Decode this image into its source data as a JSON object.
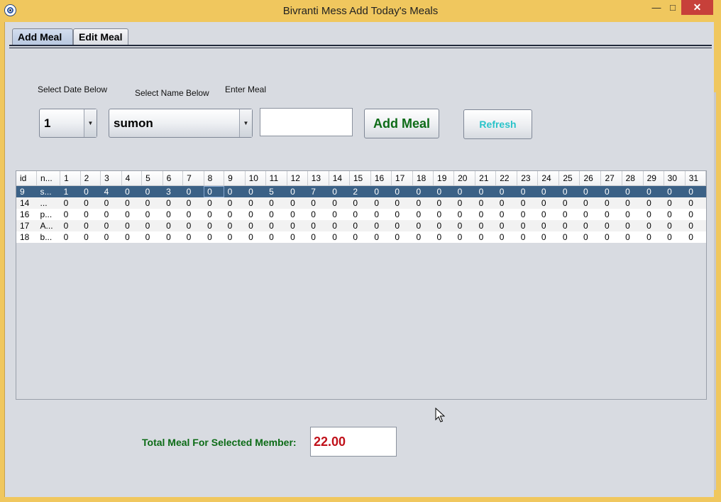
{
  "window": {
    "title": "Bivranti Mess Add Today's Meals",
    "min_glyph": "—",
    "max_glyph": "□",
    "close_glyph": "✕",
    "app_icon": "gear-logo-icon"
  },
  "tabs": [
    {
      "label": "Add Meal",
      "active": true
    },
    {
      "label": "Edit Meal",
      "active": false
    }
  ],
  "form": {
    "date_label": "Select Date Below",
    "name_label": "Select Name Below",
    "meal_label": "Enter Meal",
    "date_value": "1",
    "name_value": "sumon",
    "meal_value": "",
    "add_button": "Add Meal",
    "refresh_button": "Refresh"
  },
  "colors": {
    "add_button_text": "#0c6b16",
    "refresh_button_text": "#29c3c9",
    "total_label": "#0c6b16",
    "total_value": "#c0111a",
    "selected_row": "#3b6186",
    "title_bar": "#f0c75e"
  },
  "table": {
    "headers": [
      "id",
      "n...",
      "1",
      "2",
      "3",
      "4",
      "5",
      "6",
      "7",
      "8",
      "9",
      "10",
      "11",
      "12",
      "13",
      "14",
      "15",
      "16",
      "17",
      "18",
      "19",
      "20",
      "21",
      "22",
      "23",
      "24",
      "25",
      "26",
      "27",
      "28",
      "29",
      "30",
      "31"
    ],
    "rows": [
      [
        "9",
        "s...",
        "1",
        "0",
        "4",
        "0",
        "0",
        "3",
        "0",
        "0",
        "0",
        "0",
        "5",
        "0",
        "7",
        "0",
        "2",
        "0",
        "0",
        "0",
        "0",
        "0",
        "0",
        "0",
        "0",
        "0",
        "0",
        "0",
        "0",
        "0",
        "0",
        "0",
        "0"
      ],
      [
        "14",
        "...",
        "0",
        "0",
        "0",
        "0",
        "0",
        "0",
        "0",
        "0",
        "0",
        "0",
        "0",
        "0",
        "0",
        "0",
        "0",
        "0",
        "0",
        "0",
        "0",
        "0",
        "0",
        "0",
        "0",
        "0",
        "0",
        "0",
        "0",
        "0",
        "0",
        "0",
        "0"
      ],
      [
        "16",
        "p...",
        "0",
        "0",
        "0",
        "0",
        "0",
        "0",
        "0",
        "0",
        "0",
        "0",
        "0",
        "0",
        "0",
        "0",
        "0",
        "0",
        "0",
        "0",
        "0",
        "0",
        "0",
        "0",
        "0",
        "0",
        "0",
        "0",
        "0",
        "0",
        "0",
        "0",
        "0"
      ],
      [
        "17",
        "A...",
        "0",
        "0",
        "0",
        "0",
        "0",
        "0",
        "0",
        "0",
        "0",
        "0",
        "0",
        "0",
        "0",
        "0",
        "0",
        "0",
        "0",
        "0",
        "0",
        "0",
        "0",
        "0",
        "0",
        "0",
        "0",
        "0",
        "0",
        "0",
        "0",
        "0",
        "0"
      ],
      [
        "18",
        "b...",
        "0",
        "0",
        "0",
        "0",
        "0",
        "0",
        "0",
        "0",
        "0",
        "0",
        "0",
        "0",
        "0",
        "0",
        "0",
        "0",
        "0",
        "0",
        "0",
        "0",
        "0",
        "0",
        "0",
        "0",
        "0",
        "0",
        "0",
        "0",
        "0",
        "0",
        "0"
      ]
    ],
    "selected_row": 0,
    "focused_col": 9
  },
  "total": {
    "label": "Total Meal For Selected Member:",
    "value": "22.00"
  }
}
